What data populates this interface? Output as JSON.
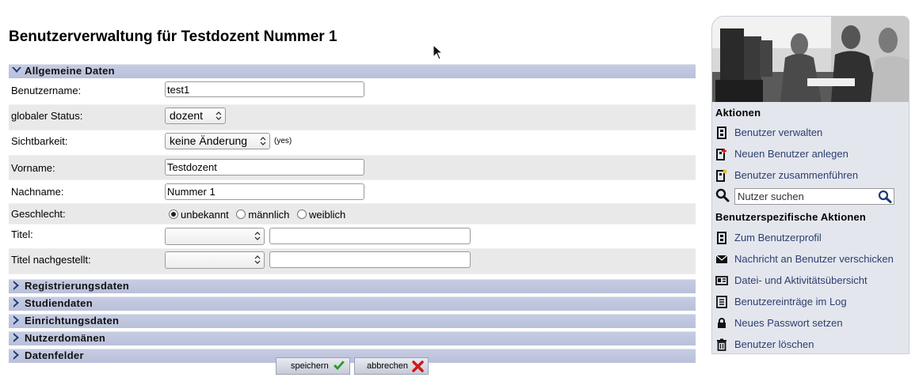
{
  "page_title": "Benutzerverwaltung für Testdozent Nummer 1",
  "form": {
    "section_general": "Allgemeine Daten",
    "fields": {
      "username": {
        "label": "Benutzername:",
        "value": "test1"
      },
      "global_status": {
        "label": "globaler Status:",
        "value": "dozent"
      },
      "visibility": {
        "label": "Sichtbarkeit:",
        "value": "keine Änderung",
        "note": "(yes)"
      },
      "firstname": {
        "label": "Vorname:",
        "value": "Testdozent"
      },
      "lastname": {
        "label": "Nachname:",
        "value": "Nummer 1"
      },
      "gender": {
        "label": "Geschlecht:",
        "options": [
          "unbekannt",
          "männlich",
          "weiblich"
        ],
        "selected": "unbekannt"
      },
      "title": {
        "label": "Titel:",
        "value": "",
        "text": ""
      },
      "title_after": {
        "label": "Titel nachgestellt:",
        "value": "",
        "text": ""
      }
    },
    "collapsed_sections": [
      "Registrierungsdaten",
      "Studiendaten",
      "Einrichtungsdaten",
      "Nutzerdomänen",
      "Datenfelder"
    ],
    "buttons": {
      "save": "speichern",
      "cancel": "abbrechen"
    }
  },
  "sidebar": {
    "actions_heading": "Aktionen",
    "actions": [
      {
        "label": "Benutzer verwalten",
        "icon": "user-manage-icon"
      },
      {
        "label": "Neuen Benutzer anlegen",
        "icon": "user-add-icon"
      },
      {
        "label": "Benutzer zusammenführen",
        "icon": "user-merge-icon"
      }
    ],
    "search_placeholder": "Nutzer suchen",
    "user_actions_heading": "Benutzerspezifische Aktionen",
    "user_actions": [
      {
        "label": "Zum Benutzerprofil",
        "icon": "profile-icon"
      },
      {
        "label": "Nachricht an Benutzer verschicken",
        "icon": "mail-icon"
      },
      {
        "label": "Datei- und Aktivitätsübersicht",
        "icon": "id-card-icon"
      },
      {
        "label": "Benutzereinträge im Log",
        "icon": "log-icon"
      },
      {
        "label": "Neues Passwort setzen",
        "icon": "lock-icon"
      },
      {
        "label": "Benutzer löschen",
        "icon": "trash-icon"
      }
    ]
  },
  "colors": {
    "link": "#2b3f6e",
    "section_header": "#c6cce2",
    "sidebar_bg": "#e4e6ee",
    "accent_green": "#2a9a2a",
    "accent_red": "#d01818"
  }
}
